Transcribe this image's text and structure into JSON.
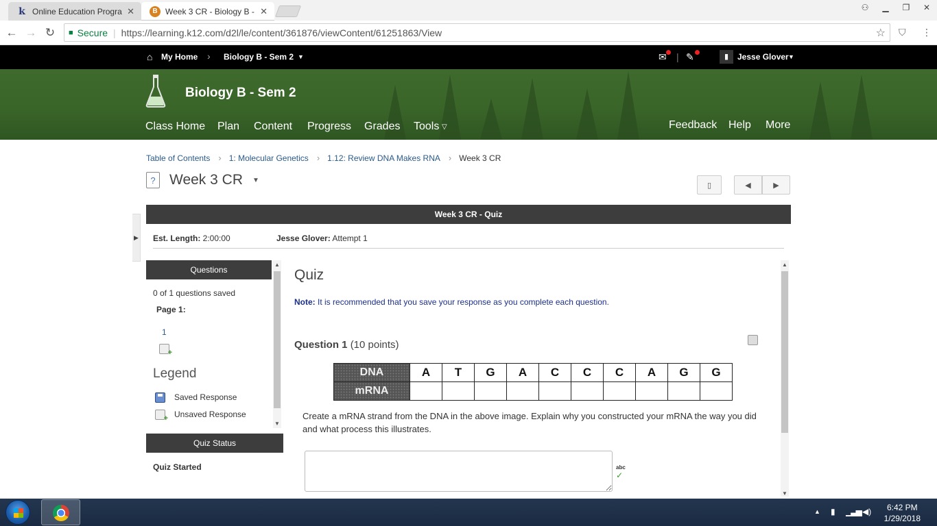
{
  "browser": {
    "tabs": [
      {
        "title": "Online Education Progra",
        "active": false
      },
      {
        "title": "Week 3 CR - Biology B - ",
        "active": true
      }
    ],
    "secure_label": "Secure",
    "url": "https://learning.k12.com/d2l/le/content/361876/viewContent/61251863/View"
  },
  "topnav": {
    "home": "My Home",
    "course": "Biology B - Sem 2",
    "user": "Jesse Glover"
  },
  "header": {
    "course_title": "Biology B - Sem 2",
    "nav_left": [
      "Class Home",
      "Plan",
      "Content",
      "Progress",
      "Grades",
      "Tools"
    ],
    "nav_right": [
      "Feedback",
      "Help",
      "More"
    ]
  },
  "breadcrumbs": [
    "Table of Contents",
    "1: Molecular Genetics",
    "1.12: Review DNA Makes RNA",
    "Week 3 CR"
  ],
  "page": {
    "title": "Week 3 CR",
    "quiz_bar": "Week 3 CR - Quiz",
    "est_length_label": "Est. Length:",
    "est_length": "2:00:00",
    "attempt_user": "Jesse Glover:",
    "attempt": "Attempt 1"
  },
  "questions_panel": {
    "header": "Questions",
    "saved_count": "0 of 1 questions saved",
    "page_label": "Page 1:",
    "question_number": "1",
    "legend_title": "Legend",
    "legend": [
      "Saved Response",
      "Unsaved Response"
    ]
  },
  "quiz_status": {
    "header": "Quiz Status",
    "status": "Quiz Started"
  },
  "quiz": {
    "title": "Quiz",
    "note_label": "Note:",
    "note_text": "It is recommended that you save your response as you complete each question.",
    "question_label": "Question 1",
    "points": "(10 points)",
    "dna_label": "DNA",
    "mrna_label": "mRNA",
    "dna_bases": [
      "A",
      "T",
      "G",
      "A",
      "C",
      "C",
      "C",
      "A",
      "G",
      "G"
    ],
    "prompt": "Create a mRNA strand from the DNA in the above image.  Explain why you constructed your mRNA the way you did and what process this illustrates.",
    "answer_value": "",
    "spell_label": "abc"
  },
  "taskbar": {
    "time": "6:42 PM",
    "date": "1/29/2018"
  },
  "colors": {
    "header_green": "#3a6529",
    "topnav_black": "#000000",
    "panel_dark": "#3d3d3d",
    "link_blue": "#2a5a8a"
  },
  "icons": [
    "home-icon",
    "chevron-right-icon",
    "caret-down-icon",
    "flask-icon",
    "bookmark-icon",
    "prev-arrow-icon",
    "next-arrow-icon",
    "floppy-save-icon",
    "unsaved-icon",
    "spellcheck-icon",
    "lock-icon",
    "star-icon"
  ]
}
